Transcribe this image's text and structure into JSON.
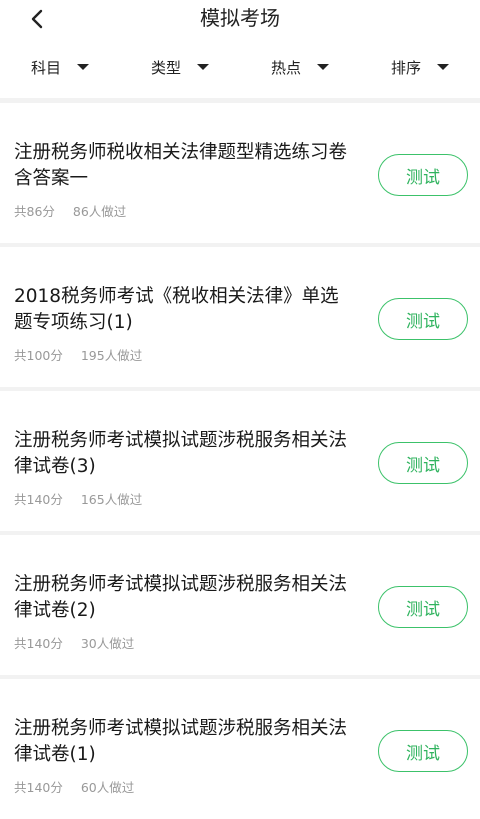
{
  "header": {
    "title": "模拟考场"
  },
  "filters": [
    {
      "label": "科目"
    },
    {
      "label": "类型"
    },
    {
      "label": "热点"
    },
    {
      "label": "排序"
    }
  ],
  "items": [
    {
      "title": "注册税务师税收相关法律题型精选练习卷含答案一",
      "score": "共86分",
      "count": "86人做过",
      "button": "测试"
    },
    {
      "title": "2018税务师考试《税收相关法律》单选题专项练习(1)",
      "score": "共100分",
      "count": "195人做过",
      "button": "测试"
    },
    {
      "title": "注册税务师考试模拟试题涉税服务相关法律试卷(3)",
      "score": "共140分",
      "count": "165人做过",
      "button": "测试"
    },
    {
      "title": "注册税务师考试模拟试题涉税服务相关法律试卷(2)",
      "score": "共140分",
      "count": "30人做过",
      "button": "测试"
    },
    {
      "title": "注册税务师考试模拟试题涉税服务相关法律试卷(1)",
      "score": "共140分",
      "count": "60人做过",
      "button": "测试"
    }
  ],
  "colors": {
    "accent": "#3cc26a",
    "muted": "#999999",
    "divider": "#f2f2f2"
  }
}
